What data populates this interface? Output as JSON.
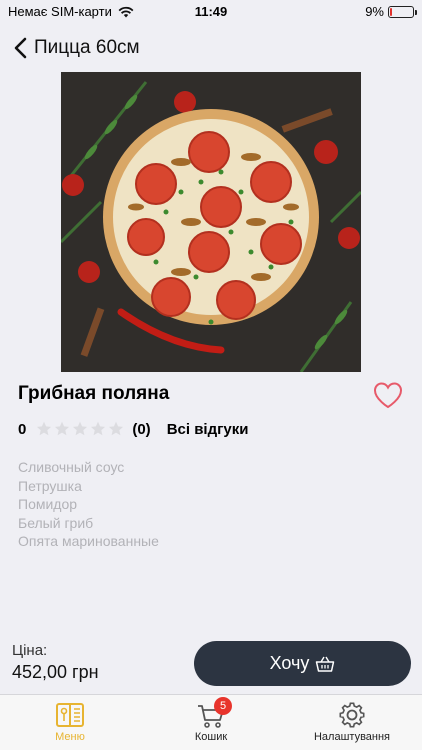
{
  "status": {
    "carrier": "Немає SIM-карти",
    "time": "11:49",
    "battery": "9%",
    "battery_level": 0.09
  },
  "nav": {
    "title": "Пицца 60см"
  },
  "product": {
    "name": "Грибная поляна",
    "rating": "0",
    "stars_filled": 0,
    "stars_total": 5,
    "review_count": "(0)",
    "all_reviews_label": "Всі відгуки",
    "ingredients": [
      "Сливочный соус",
      "Петрушка",
      "Помидор",
      "Белый гриб",
      "Опята маринованные"
    ]
  },
  "price": {
    "label": "Ціна:",
    "value": "452,00 грн"
  },
  "want_button": {
    "label": "Хочу"
  },
  "tabs": [
    {
      "label": "Меню",
      "icon": "menu-book-icon",
      "active": true
    },
    {
      "label": "Кошик",
      "icon": "cart-icon",
      "badge": "5"
    },
    {
      "label": "Налаштування",
      "icon": "gear-icon"
    }
  ],
  "colors": {
    "accent": "#e7b431",
    "button": "#2c3441",
    "badge": "#e8342c",
    "heart": "#e75a6a",
    "ingredient_text": "#b2b2b7"
  }
}
